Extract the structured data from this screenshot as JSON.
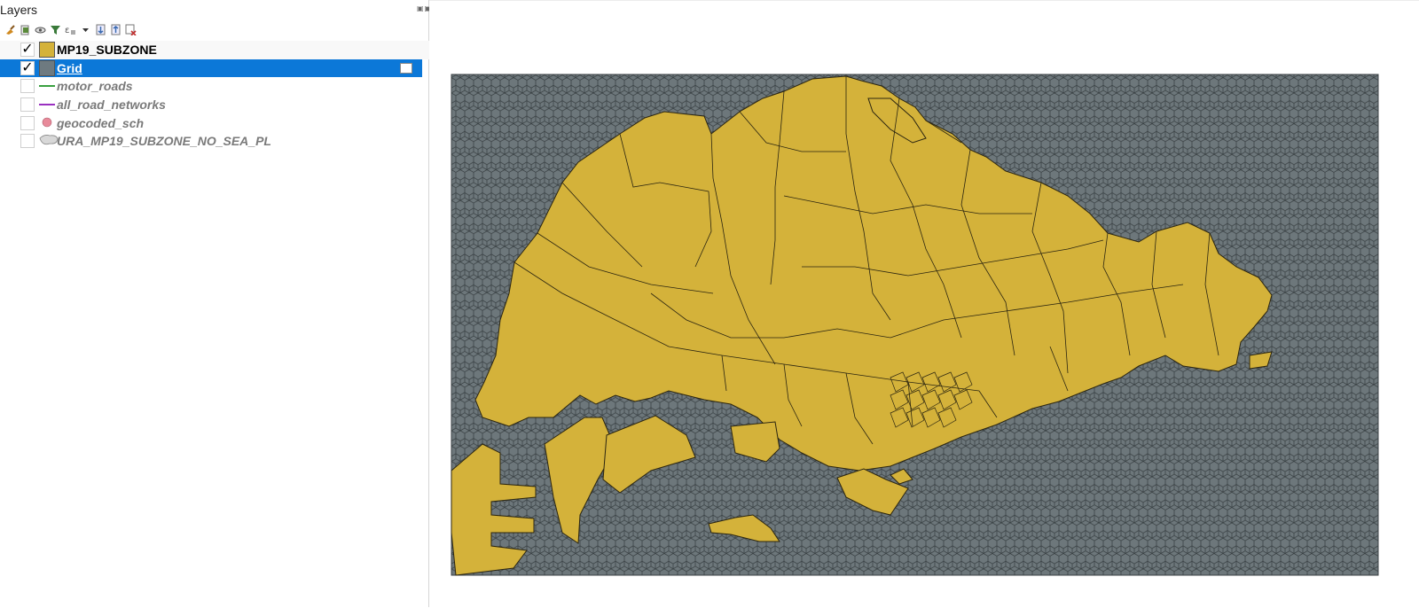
{
  "panel": {
    "title": "Layers",
    "controls": "▣▣",
    "toolbar": [
      {
        "name": "style-manager-icon",
        "color": "#d08a20"
      },
      {
        "name": "add-group-icon",
        "color": "#5a8a3a"
      },
      {
        "name": "manage-visibility-icon",
        "color": "#555555"
      },
      {
        "name": "filter-legend-icon",
        "color": "#3a7a3a"
      },
      {
        "name": "filter-expression-icon",
        "color": "#555555"
      },
      {
        "name": "dropdown-arrow-icon",
        "color": "#333333"
      },
      {
        "name": "expand-all-icon",
        "color": "#3a6ab0"
      },
      {
        "name": "collapse-all-icon",
        "color": "#3a6ab0"
      },
      {
        "name": "remove-layer-icon",
        "color": "#c03030"
      }
    ],
    "layers": [
      {
        "label": "MP19_SUBZONE",
        "checked": true,
        "symbol": "fill",
        "symbol_color": "#d4b23a",
        "state": "active"
      },
      {
        "label": "Grid",
        "checked": true,
        "symbol": "fill",
        "symbol_color": "#6e7a80",
        "state": "selected"
      },
      {
        "label": "motor_roads",
        "checked": false,
        "symbol": "line",
        "symbol_color": "#3aa040",
        "state": "inactive"
      },
      {
        "label": "all_road_networks",
        "checked": false,
        "symbol": "line",
        "symbol_color": "#9a30c0",
        "state": "inactive"
      },
      {
        "label": "geocoded_sch",
        "checked": false,
        "symbol": "point",
        "symbol_color": "#e88a9a",
        "state": "inactive"
      },
      {
        "label": "URA_MP19_SUBZONE_NO_SEA_PL",
        "checked": false,
        "symbol": "polygon-outline",
        "symbol_color": "#d8d8d8",
        "state": "inactive"
      }
    ],
    "check_glyph": "✓"
  },
  "map": {
    "grid_fill": "#6d777b",
    "grid_stroke": "#3b4245",
    "land_fill": "#d4b23a",
    "land_stroke": "#2b2510",
    "background": "#ffffff"
  }
}
